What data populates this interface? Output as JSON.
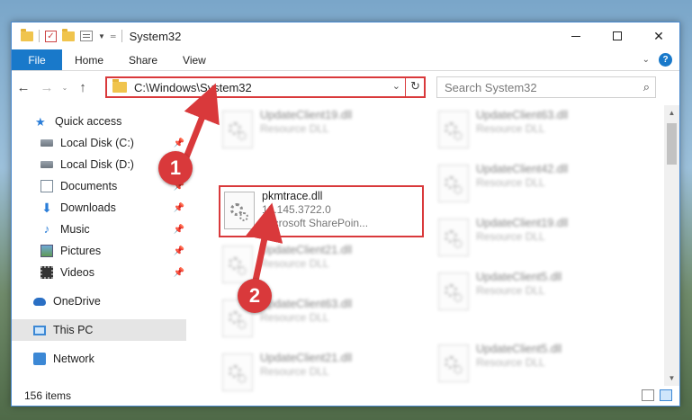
{
  "window": {
    "title": "System32"
  },
  "ribbon": {
    "tabs": [
      "File",
      "Home",
      "Share",
      "View"
    ]
  },
  "address": {
    "path": "C:\\Windows\\System32"
  },
  "search": {
    "placeholder": "Search System32"
  },
  "nav": {
    "items": [
      {
        "label": "Quick access",
        "icon": "star-icon",
        "pinned": false
      },
      {
        "label": "Local Disk (C:)",
        "icon": "drive-icon",
        "pinned": true
      },
      {
        "label": "Local Disk (D:)",
        "icon": "drive-icon",
        "pinned": false
      },
      {
        "label": "Documents",
        "icon": "documents-icon",
        "pinned": true
      },
      {
        "label": "Downloads",
        "icon": "download-icon",
        "pinned": true
      },
      {
        "label": "Music",
        "icon": "music-icon",
        "pinned": true
      },
      {
        "label": "Pictures",
        "icon": "pictures-icon",
        "pinned": true
      },
      {
        "label": "Videos",
        "icon": "videos-icon",
        "pinned": true
      },
      {
        "label": "OneDrive",
        "icon": "onedrive-icon",
        "pinned": false
      },
      {
        "label": "This PC",
        "icon": "this-pc-icon",
        "pinned": false,
        "selected": true
      },
      {
        "label": "Network",
        "icon": "network-icon",
        "pinned": false
      }
    ]
  },
  "files": {
    "left": [
      {
        "name": "UpdateClient19.dll",
        "sub": "Resource DLL"
      },
      {
        "name": "pkmtrace.dll",
        "sub": "10.145.3722.0",
        "sub2": "Microsoft SharePoin...",
        "highlighted": true
      },
      {
        "name": "UpdateClient21.dll",
        "sub": "Resource DLL"
      },
      {
        "name": "UpdateClient63.dll",
        "sub": "Resource DLL"
      },
      {
        "name": "UpdateClient21.dll",
        "sub": "Resource DLL"
      }
    ],
    "right": [
      {
        "name": "UpdateClient63.dll",
        "sub": "Resource DLL"
      },
      {
        "name": "UpdateClient42.dll",
        "sub": "Resource DLL"
      },
      {
        "name": "UpdateClient19.dll",
        "sub": "Resource DLL"
      },
      {
        "name": "UpdateClient5.dll",
        "sub": "Resource DLL"
      },
      {
        "name": "UpdateClient5.dll",
        "sub": "Resource DLL"
      }
    ]
  },
  "status": {
    "count": "156 items"
  },
  "annotations": {
    "step1": "1",
    "step2": "2",
    "color": "#d9393b"
  }
}
